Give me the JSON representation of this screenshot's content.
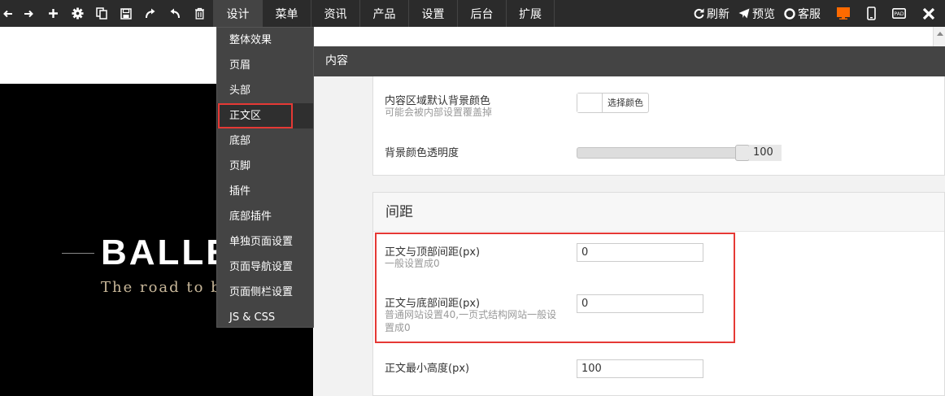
{
  "toolbar": {
    "icons": [
      "arrow-left-icon",
      "arrow-right-icon",
      "plus-icon",
      "gear-icon",
      "copy-icon",
      "save-icon",
      "redo-icon",
      "undo-icon",
      "trash-icon"
    ],
    "menu": [
      {
        "label": "设计",
        "active": true
      },
      {
        "label": "菜单"
      },
      {
        "label": "资讯"
      },
      {
        "label": "产品"
      },
      {
        "label": "设置"
      },
      {
        "label": "后台"
      },
      {
        "label": "扩展"
      }
    ],
    "refresh_label": "刷新",
    "preview_label": "预览",
    "service_label": "客服",
    "devices": [
      "desktop-icon",
      "mobile-icon",
      "pad-icon"
    ],
    "accent_color": "#ff6a00"
  },
  "preview": {
    "brand_text": "BALLE",
    "tagline": "The road to b"
  },
  "dropdown": {
    "items": [
      "整体效果",
      "页眉",
      "头部",
      "正文区",
      "底部",
      "页脚",
      "插件",
      "底部插件",
      "单独页面设置",
      "页面导航设置",
      "页面侧栏设置",
      "JS & CSS"
    ],
    "active_index": 3
  },
  "panel": {
    "header": "内容",
    "bg_color_label": "内容区域默认背景颜色",
    "bg_color_hint": "可能会被内部设置覆盖掉",
    "color_button": "选择颜色",
    "opacity_label": "背景颜色透明度",
    "opacity_value": "100",
    "opacity_fraction": 1.0,
    "spacing_title": "间距",
    "top_spacing_label": "正文与顶部间距(px)",
    "top_spacing_hint": "一般设置成0",
    "top_spacing_value": "0",
    "bottom_spacing_label": "正文与底部间距(px)",
    "bottom_spacing_hint": "普通网站设置40,一页式结构网站一般设置成0",
    "bottom_spacing_value": "0",
    "min_height_label": "正文最小高度(px)",
    "min_height_value": "100"
  },
  "colors": {
    "highlight_red": "#e53935",
    "toolbar_bg": "#2b2b2b"
  }
}
